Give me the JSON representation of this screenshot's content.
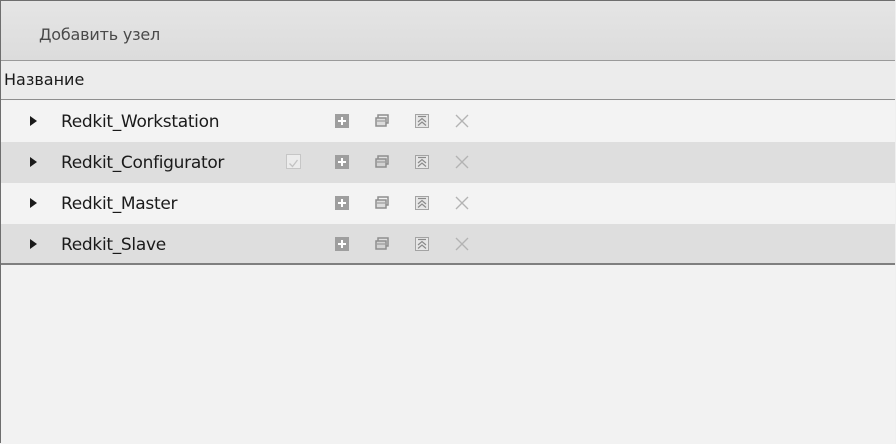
{
  "toolbar": {
    "add_node_label": "Добавить узел"
  },
  "table": {
    "header": "Название",
    "rows": [
      {
        "name": "Redkit_Workstation",
        "has_checkbox": false
      },
      {
        "name": "Redkit_Configurator",
        "has_checkbox": true,
        "checkbox_checked": true
      },
      {
        "name": "Redkit_Master",
        "has_checkbox": false
      },
      {
        "name": "Redkit_Slave",
        "has_checkbox": false
      }
    ]
  },
  "icons": {
    "add": "plus-square-icon",
    "copy": "copy-window-icon",
    "move_up": "move-up-icon",
    "delete": "close-x-icon"
  },
  "colors": {
    "row_odd": "#f3f3f3",
    "row_even": "#dedede",
    "icon_gray": "#a6a6a6",
    "text": "#1a1a1a"
  }
}
